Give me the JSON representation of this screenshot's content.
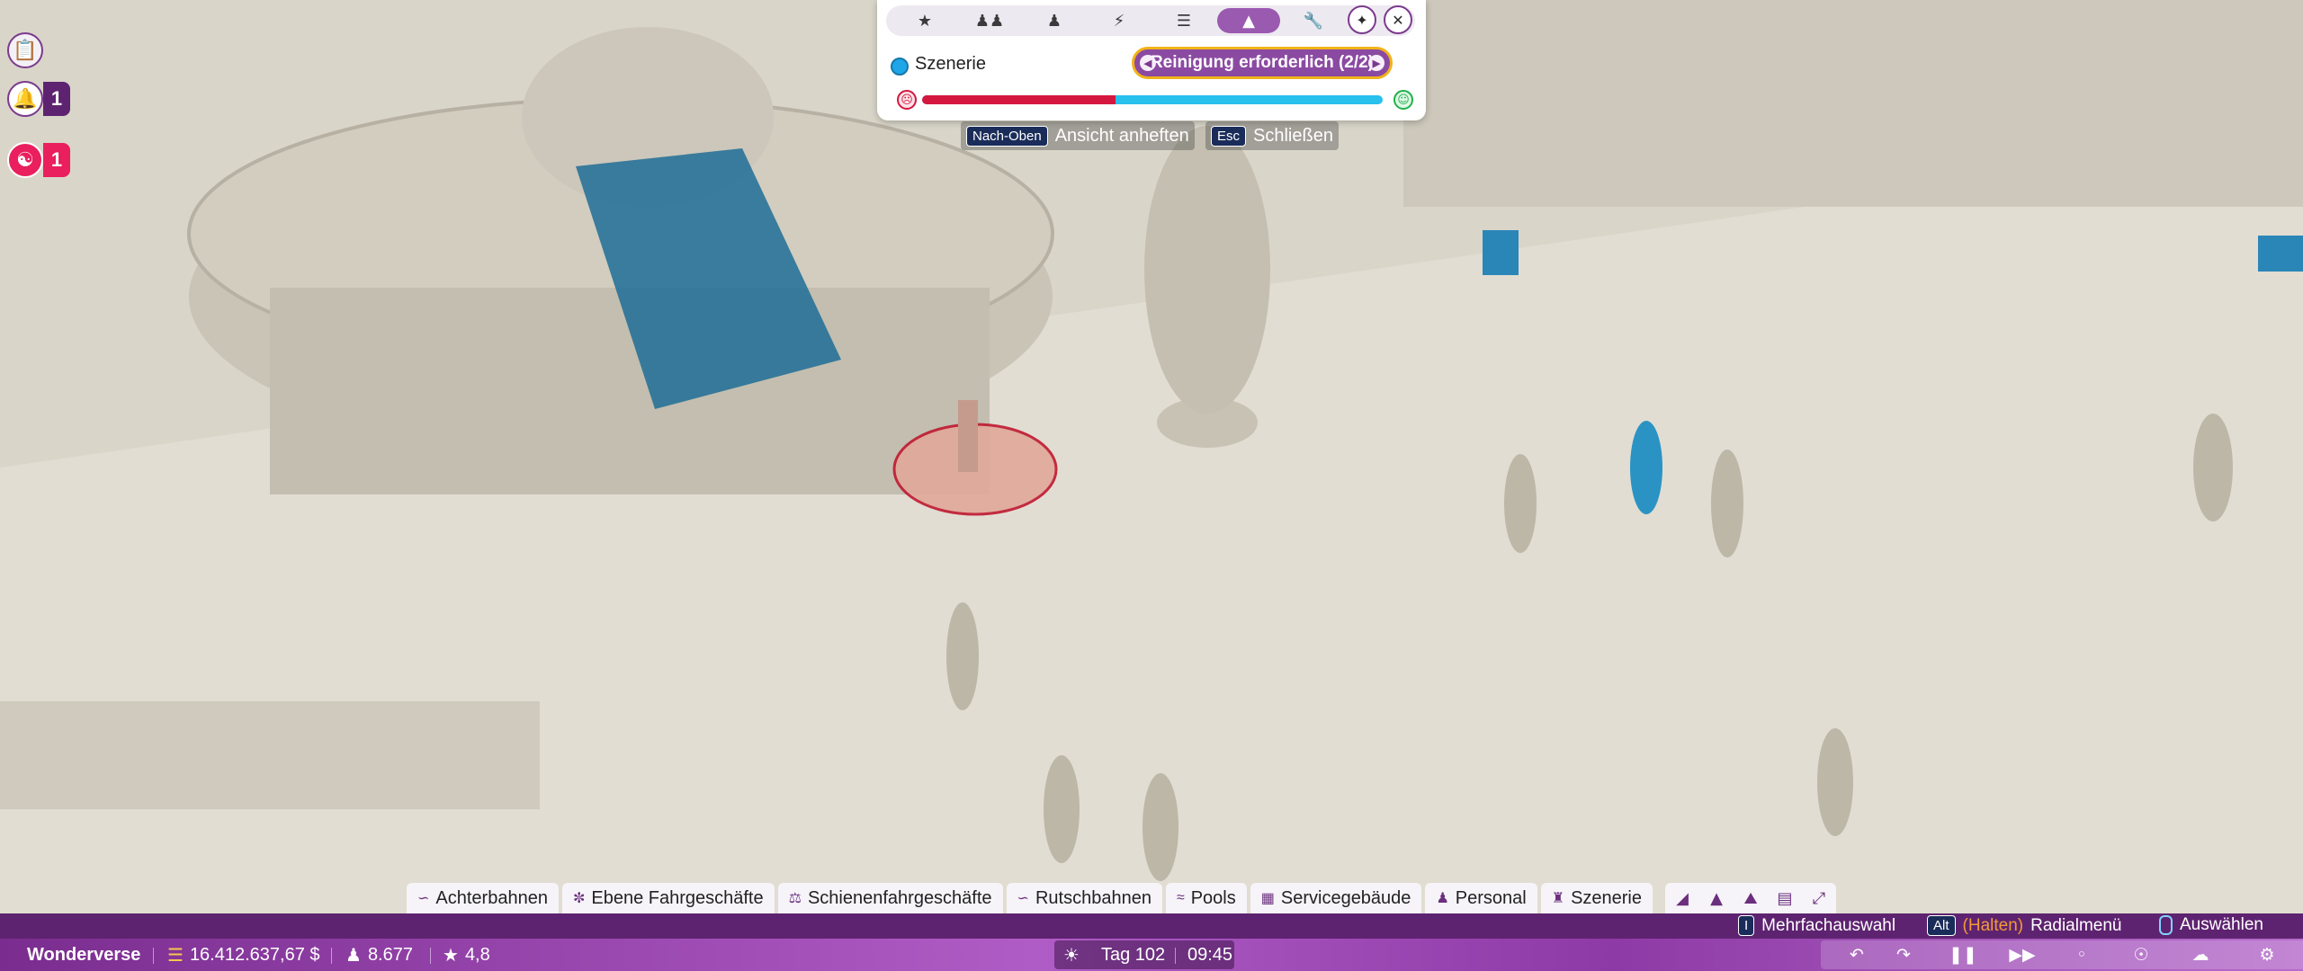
{
  "side": {
    "notif_count": "1",
    "guest_count": "1"
  },
  "panel": {
    "tabs": [
      {
        "icon": "guest-star-icon"
      },
      {
        "icon": "group-icon"
      },
      {
        "icon": "person-icon"
      },
      {
        "icon": "energy-drop-icon"
      },
      {
        "icon": "coins-icon"
      },
      {
        "icon": "scenery-tree-icon",
        "active": true
      },
      {
        "icon": "wrench-icon"
      }
    ],
    "object_label": "Szenerie",
    "status": "Reinigung erforderlich (2/2)",
    "condition_fraction": 0.42,
    "colors": {
      "accent": "#8b4aa2",
      "bad": "#d4173f",
      "good": "#28c0ec",
      "highlight": "#f2b318"
    }
  },
  "hints": {
    "pin_key": "Nach-Oben",
    "pin_label": "Ansicht anheften",
    "close_key": "Esc",
    "close_label": "Schließen"
  },
  "categories": [
    {
      "label": "Achterbahnen",
      "icon": "coaster-icon"
    },
    {
      "label": "Ebene Fahrgeschäfte",
      "icon": "flat-ride-icon"
    },
    {
      "label": "Schienenfahrgeschäfte",
      "icon": "track-ride-icon"
    },
    {
      "label": "Rutschbahnen",
      "icon": "slide-icon"
    },
    {
      "label": "Pools",
      "icon": "pool-icon"
    },
    {
      "label": "Servicegebäude",
      "icon": "shop-icon"
    },
    {
      "label": "Personal",
      "icon": "staff-icon"
    },
    {
      "label": "Szenerie",
      "icon": "scenery-icon"
    }
  ],
  "bottom_hints": {
    "multi_key": "I",
    "multi_label": "Mehrfachauswahl",
    "radial_key": "Alt",
    "radial_hold": "(Halten)",
    "radial_label": "Radialmenü",
    "select_label": "Auswählen"
  },
  "status": {
    "park_name": "Wonderverse",
    "money": "16.412.637,67 $",
    "guests": "8.677",
    "rating": "4,8",
    "day": "Tag 102",
    "time": "09:45"
  }
}
